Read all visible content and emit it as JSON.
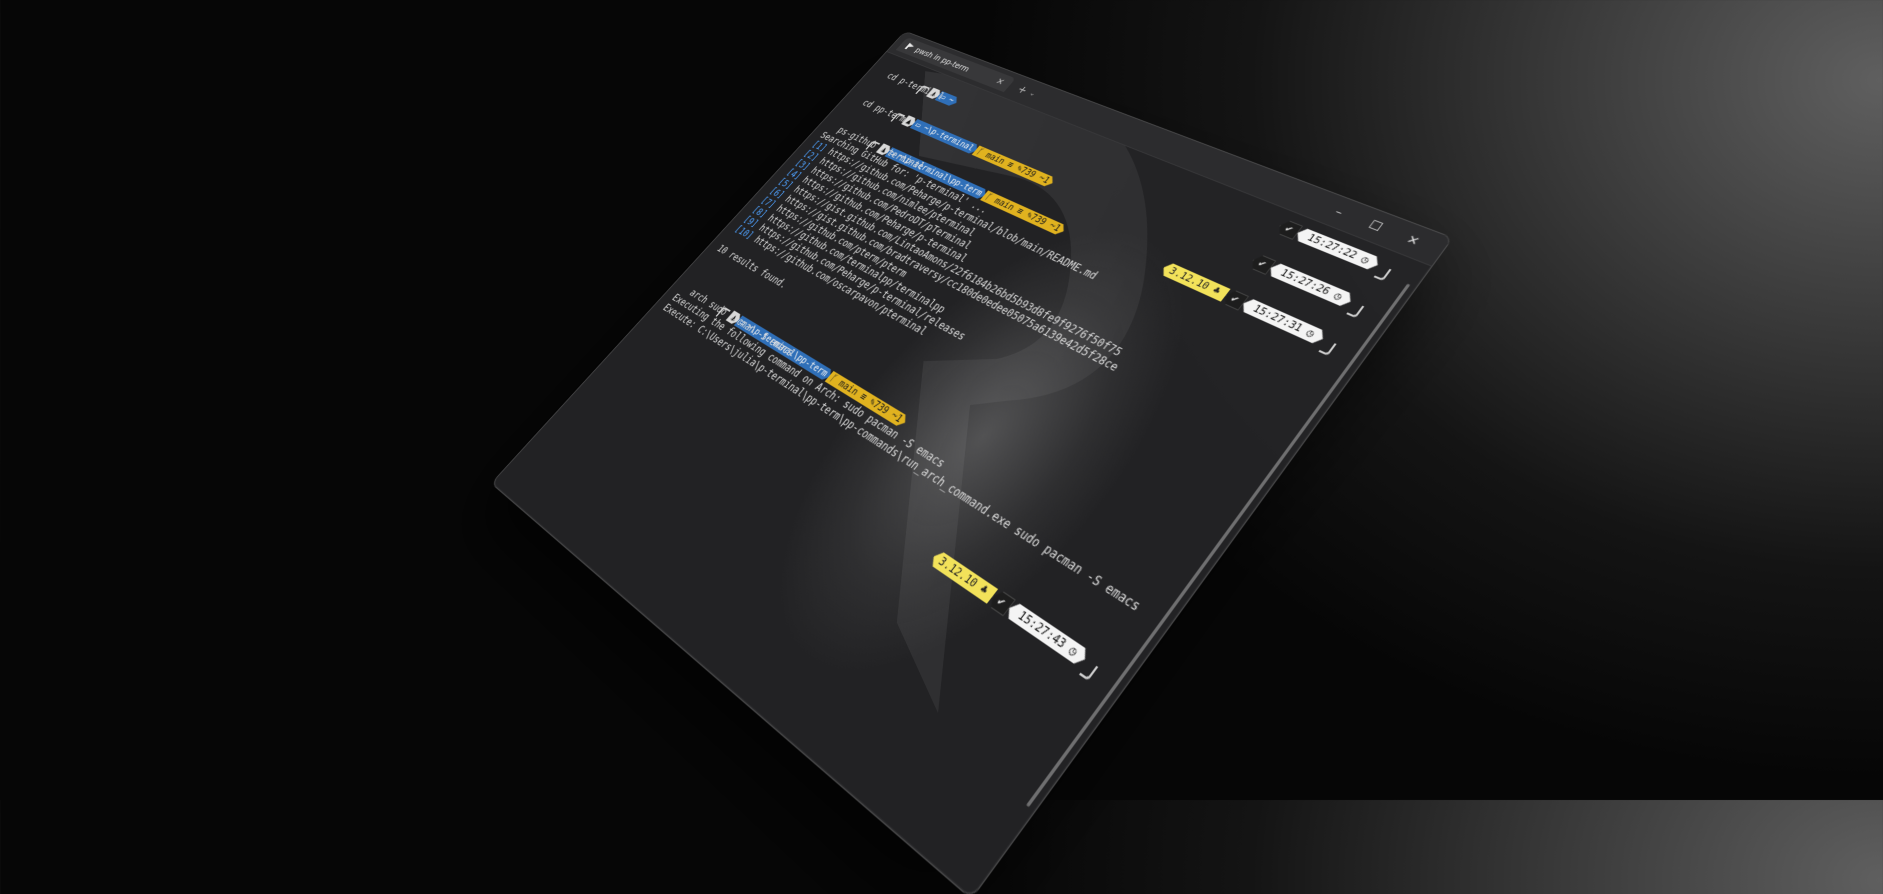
{
  "window": {
    "tab_title": "pwsh in pp-term",
    "tab_close": "✕",
    "tab_new": "+",
    "tab_dropdown": "⌄",
    "minimize": "–",
    "maximize": "☐",
    "close": "✕"
  },
  "prompts": [
    {
      "path": "~",
      "git": "",
      "command": "cd p-terminal"
    },
    {
      "path": "~\\p-terminal",
      "git": "main ≡ ✎739 ~1",
      "command": "cd pp-term"
    },
    {
      "path": "~\\p-terminal\\pp-term",
      "git": "main ≡ ✎739 ~1",
      "command": "ps-github p-terminal"
    }
  ],
  "search": {
    "header": "Searching GitHub for: 'p-terminal' ...",
    "results": [
      {
        "n": "[1]",
        "url": "https://github.com/Peharge/p-terminal/blob/main/README.md"
      },
      {
        "n": "[2]",
        "url": "https://github.com/nimlee/pterminal"
      },
      {
        "n": "[3]",
        "url": "https://github.com/PedroDT/pTerminal"
      },
      {
        "n": "[4]",
        "url": "https://github.com/Peharge/p-terminal"
      },
      {
        "n": "[5]",
        "url": "https://gist.github.com/LintaoAmons/22f6184b26bd5b93d8fe9f9276f50f75"
      },
      {
        "n": "[6]",
        "url": "https://gist.github.com/bradtraversy/cc180de0edee05075a6139e42d5f28ce"
      },
      {
        "n": "[7]",
        "url": "https://github.com/pterm/pterm"
      },
      {
        "n": "[8]",
        "url": "https://github.com/terminalpp/terminalpp"
      },
      {
        "n": "[9]",
        "url": "https://github.com/Peharge/p-terminal/releases"
      },
      {
        "n": "[10]",
        "url": "https://github.com/oscarpavon/pterminal"
      }
    ],
    "footer": "10 results found."
  },
  "last_prompt": {
    "path": "~\\p-terminal\\pp-term",
    "git": "main ≡ ✎739 ~1",
    "command": "arch sudo pacman -S emacs"
  },
  "output": [
    "Executing the following command on Arch: sudo pacman -S emacs",
    "Execute: C:\\Users\\julia\\p-terminal\\pp-term\\pp-commands\\run_arch_command.exe sudo pacman -S emacs"
  ],
  "right_prompts": [
    {
      "python": "",
      "ok": "✔",
      "time": "15:27:22 ◷"
    },
    {
      "python": "",
      "ok": "✔",
      "time": "15:27:26 ◷"
    },
    {
      "python": "3.12.10 ♣",
      "ok": "✔",
      "time": "15:27:31 ◷"
    },
    {
      "python": "3.12.10 ♣",
      "ok": "✔",
      "time": "15:27:43 ◷"
    }
  ],
  "icons": {
    "os": "arch-linux-icon",
    "folder": "folder-icon",
    "git": "git-branch-icon",
    "python": "python-icon",
    "clock": "clock-icon",
    "check": "check-icon"
  },
  "colors": {
    "path_segment": "#2f6fb8",
    "git_segment": "#e0b21f",
    "python_segment": "#f2e25a",
    "time_segment": "#f4f4f4",
    "window_bg": "#242426"
  }
}
